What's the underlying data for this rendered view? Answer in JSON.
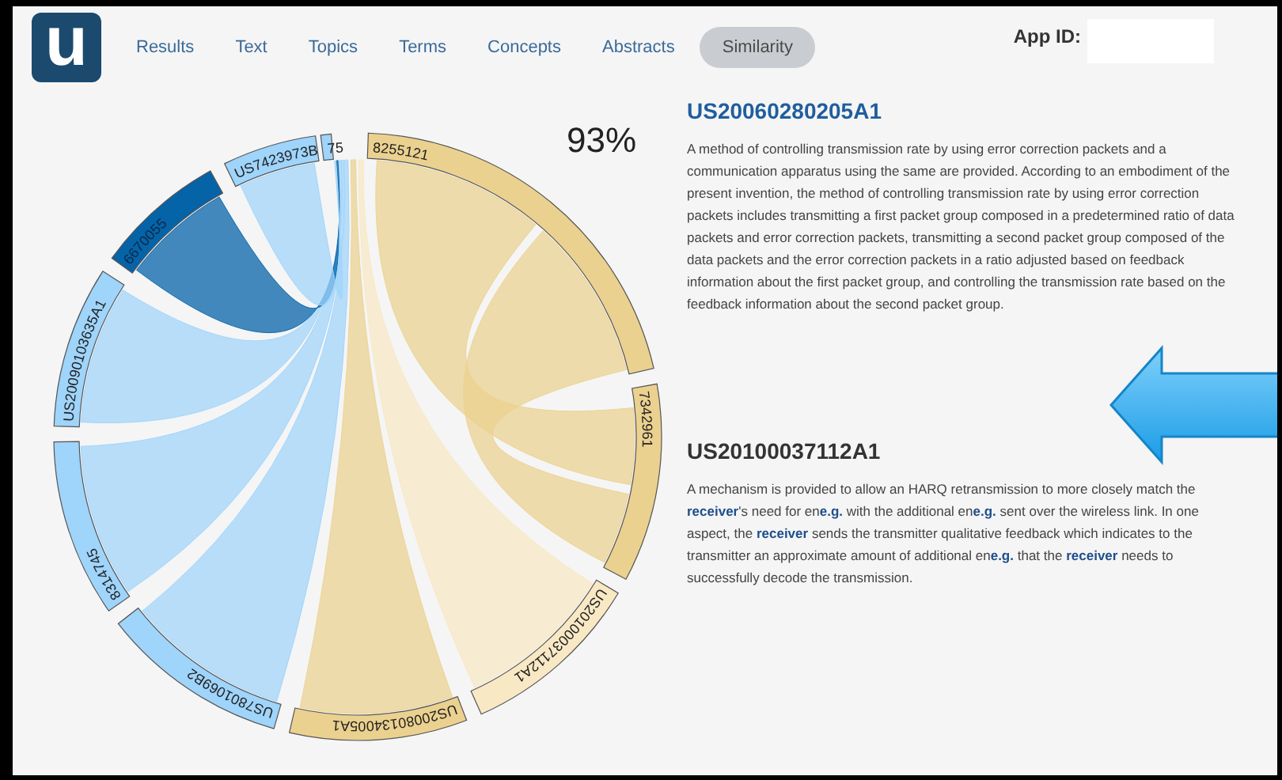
{
  "logo": "u",
  "tabs": [
    {
      "label": "Results",
      "selected": false
    },
    {
      "label": "Text",
      "selected": false
    },
    {
      "label": "Topics",
      "selected": false
    },
    {
      "label": "Terms",
      "selected": false
    },
    {
      "label": "Concepts",
      "selected": false
    },
    {
      "label": "Abstracts",
      "selected": false
    },
    {
      "label": "Similarity",
      "selected": true
    }
  ],
  "app_id": {
    "label": "App ID:"
  },
  "similarity": "93%",
  "groups": [
    {
      "label": "8255121",
      "color": "#ebd18f"
    },
    {
      "label": "7342961",
      "color": "#ebd18f"
    },
    {
      "label": "US20100037112A1",
      "color": "#f8e8c4"
    },
    {
      "label": "US20080134005A1",
      "color": "#ebd18f"
    },
    {
      "label": "US7801069B2",
      "color": "#9fd4fb"
    },
    {
      "label": "8314745",
      "color": "#9fd4fb"
    },
    {
      "label": "US20090103635A1",
      "color": "#9fd4fb"
    },
    {
      "label": "6670055",
      "color": "#0563a8"
    },
    {
      "label": "US7423973B",
      "color": "#9fd4fb"
    },
    {
      "label": "75",
      "color": "#9fd4fb"
    }
  ],
  "documents": [
    {
      "title": "US20060280205A1",
      "highlighted": true,
      "abstract": "A method of controlling transmission rate by using error correction packets and a communication apparatus using the same are provided. According to an embodiment of the present invention, the method of controlling transmission rate by using error correction packets includes transmitting a first packet group composed in a predetermined ratio of data packets and error correction packets, transmitting a second packet group composed of the data packets and the error correction packets in a ratio adjusted based on feedback information about the first packet group, and controlling the transmission rate based on the feedback information about the second packet group."
    },
    {
      "title": "US20100037112A1",
      "highlighted": false,
      "abstract": "A mechanism is provided to allow an HARQ retransmission to more closely match the **receiver**'s need for en**e.g.** with the additional en**e.g.** sent over the wireless link. In one aspect, the **receiver** sends the transmitter qualitative feedback which indicates to the transmitter an approximate amount of additional en**e.g.** that the **receiver** needs to successfully decode the transmission."
    }
  ]
}
